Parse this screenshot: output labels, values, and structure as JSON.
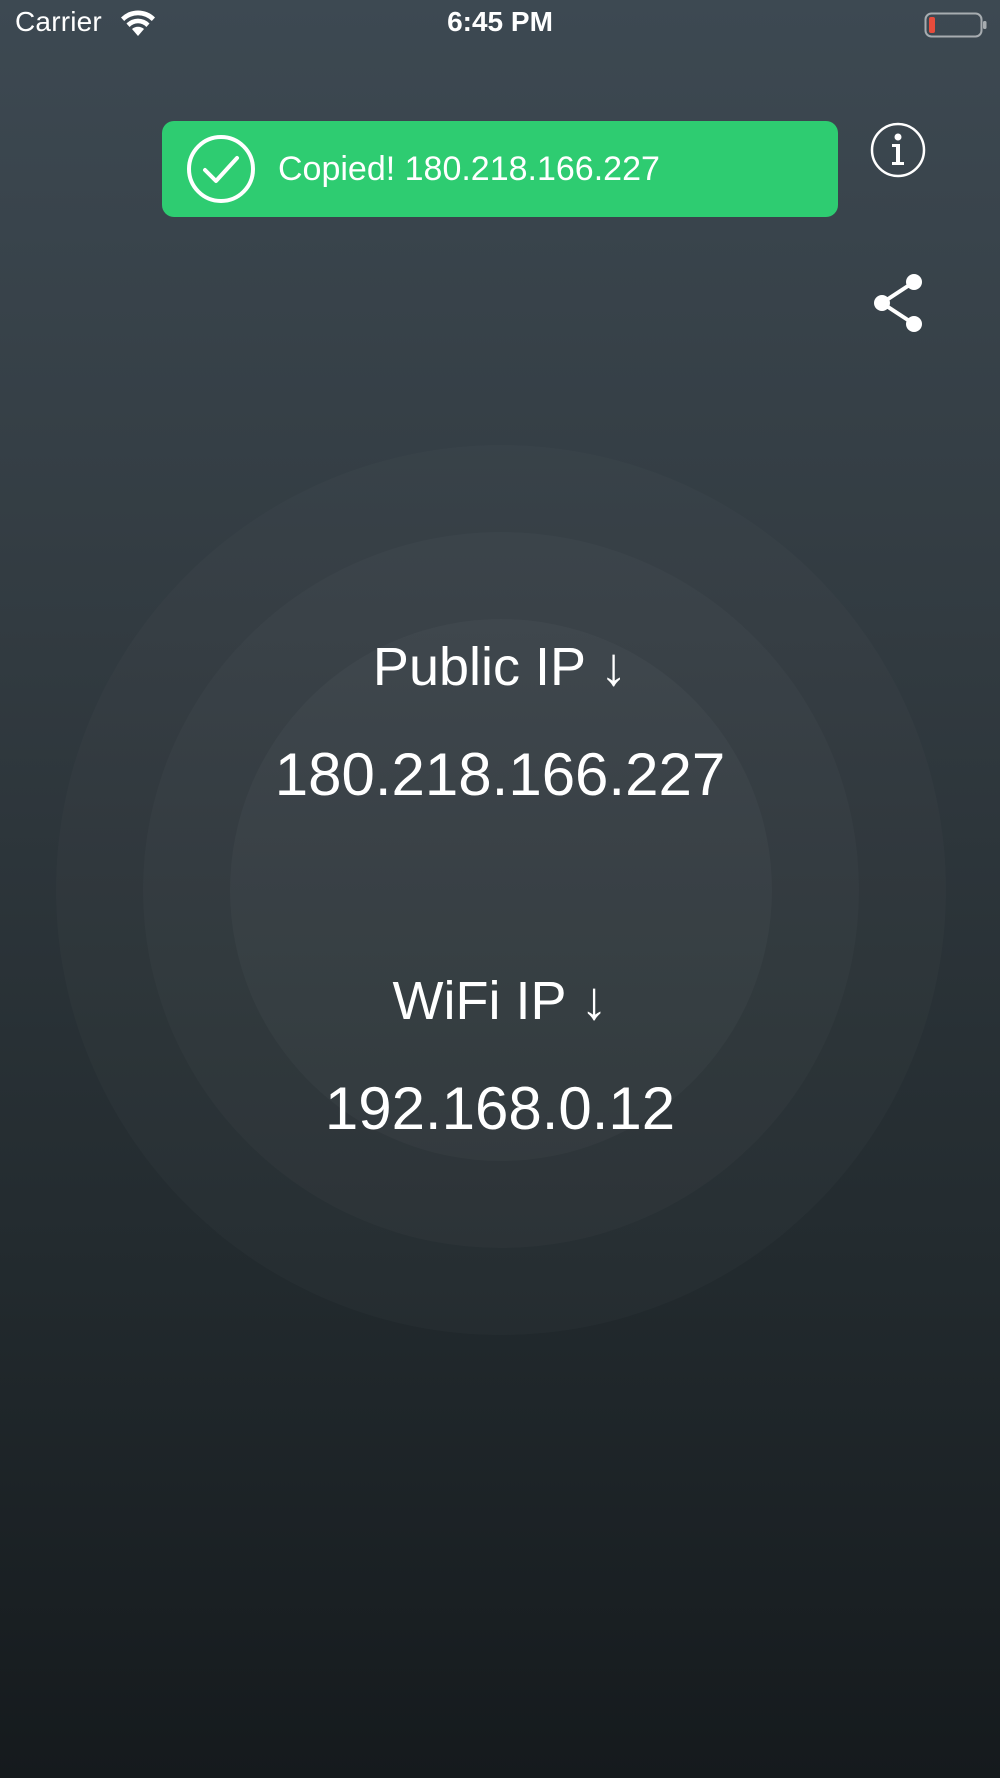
{
  "status_bar": {
    "carrier": "Carrier",
    "time": "6:45 PM",
    "wifi_icon": "wifi-icon",
    "battery_icon": "battery-low-icon",
    "battery_color": "#e74c3c"
  },
  "toast": {
    "icon": "checkmark-circle-icon",
    "message": "Copied! 180.218.166.227",
    "color": "#2ecc71"
  },
  "toolbar": {
    "info_icon": "info-icon",
    "share_icon": "share-icon"
  },
  "public_ip": {
    "label": "Public IP ↓",
    "value": "180.218.166.227"
  },
  "wifi_ip": {
    "label": "WiFi IP ↓",
    "value": "192.168.0.12"
  }
}
